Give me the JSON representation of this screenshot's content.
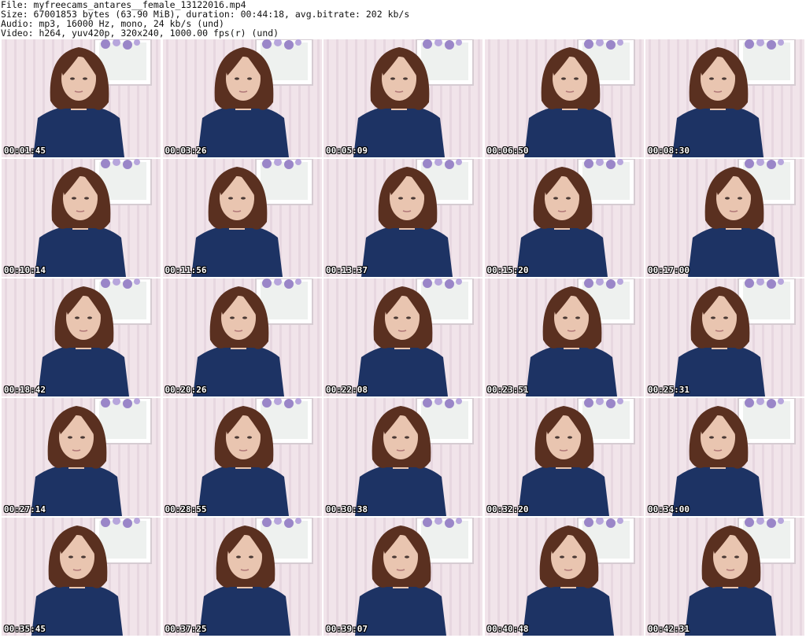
{
  "header": {
    "file_line": "File: myfreecams_antares__female_13122016.mp4",
    "size_line": "Size: 67001853 bytes (63.90 MiB), duration: 00:44:18, avg.bitrate: 202 kb/s",
    "audio_line": "Audio: mp3, 16000 Hz, mono, 24 kb/s (und)",
    "video_line": "Video: h264, yuv420p, 320x240, 1000.00 fps(r) (und)"
  },
  "thumbnails": [
    {
      "timestamp": "00:01:45"
    },
    {
      "timestamp": "00:03:26"
    },
    {
      "timestamp": "00:05:09"
    },
    {
      "timestamp": "00:06:50"
    },
    {
      "timestamp": "00:08:30"
    },
    {
      "timestamp": "00:10:14"
    },
    {
      "timestamp": "00:11:56"
    },
    {
      "timestamp": "00:13:37"
    },
    {
      "timestamp": "00:15:20"
    },
    {
      "timestamp": "00:17:00"
    },
    {
      "timestamp": "00:18:42"
    },
    {
      "timestamp": "00:20:26"
    },
    {
      "timestamp": "00:22:08"
    },
    {
      "timestamp": "00:23:51"
    },
    {
      "timestamp": "00:25:31"
    },
    {
      "timestamp": "00:27:14"
    },
    {
      "timestamp": "00:28:55"
    },
    {
      "timestamp": "00:30:38"
    },
    {
      "timestamp": "00:32:20"
    },
    {
      "timestamp": "00:34:00"
    },
    {
      "timestamp": "00:35:45"
    },
    {
      "timestamp": "00:37:25"
    },
    {
      "timestamp": "00:39:07"
    },
    {
      "timestamp": "00:40:48"
    },
    {
      "timestamp": "00:42:31"
    }
  ],
  "colors": {
    "wall": "#f1e4ea",
    "stripe": "#e3d1db",
    "sweater": "#1d3364",
    "hair": "#5a3020",
    "skin": "#e9c5b0",
    "frame": "#ffffff",
    "flower": "#9a86c8"
  }
}
